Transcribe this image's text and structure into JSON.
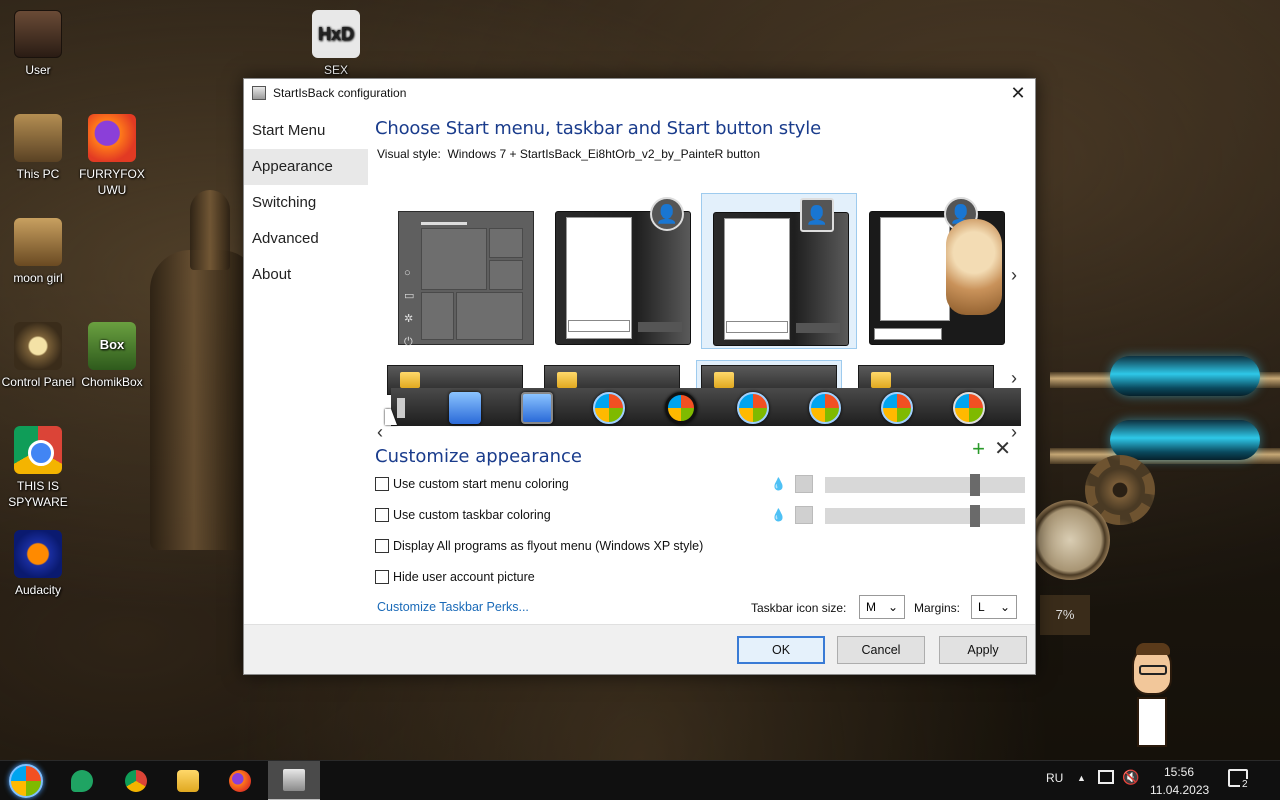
{
  "desktop": {
    "icons": [
      {
        "label": "User"
      },
      {
        "label": "SEX",
        "glyph": "HxD"
      },
      {
        "label": "This PC"
      },
      {
        "label": "FURRYFOX UWU"
      },
      {
        "label": "moon girl"
      },
      {
        "label": "Control Panel"
      },
      {
        "label": "ChomikBox",
        "glyph": "Box"
      },
      {
        "label": "THIS IS SPYWARE"
      },
      {
        "label": "Audacity"
      }
    ],
    "gauge_text": "7%"
  },
  "dialog": {
    "title": "StartIsBack configuration",
    "close_glyph": "✕",
    "nav": [
      "Start Menu",
      "Appearance",
      "Switching",
      "Advanced",
      "About"
    ],
    "heading": "Choose Start menu, taskbar and Start button style",
    "visual_style_label": "Visual style:",
    "visual_style_value": "Windows 7 + StartIsBack_Ei8htOrb_v2_by_PainteR button",
    "customize_heading": "Customize appearance",
    "options": [
      {
        "label": "Use custom start menu coloring",
        "checked": false
      },
      {
        "label": "Use custom taskbar coloring",
        "checked": false
      },
      {
        "label": "Display All programs as flyout menu (Windows XP style)",
        "checked": false
      },
      {
        "label": "Hide user account picture",
        "checked": false
      }
    ],
    "slider_levels": [
      0.75,
      0.75
    ],
    "link": "Customize Taskbar Perks...",
    "icon_size_label": "Taskbar icon size:",
    "icon_size_value": "M",
    "margins_label": "Margins:",
    "margins_value": "L",
    "buttons": {
      "ok": "OK",
      "cancel": "Cancel",
      "apply": "Apply"
    },
    "arrows": {
      "left": "‹",
      "right": "›"
    },
    "plus_glyph": "+",
    "x_glyph": "✕"
  },
  "taskbar": {
    "lang": "RU",
    "time": "15:56",
    "date": "11.04.2023",
    "notification_count": "2",
    "tray_up": "▲"
  },
  "colors": {
    "accent": "#1a3c8c",
    "link": "#1a6ab8",
    "selection": "#e3f0fb"
  }
}
